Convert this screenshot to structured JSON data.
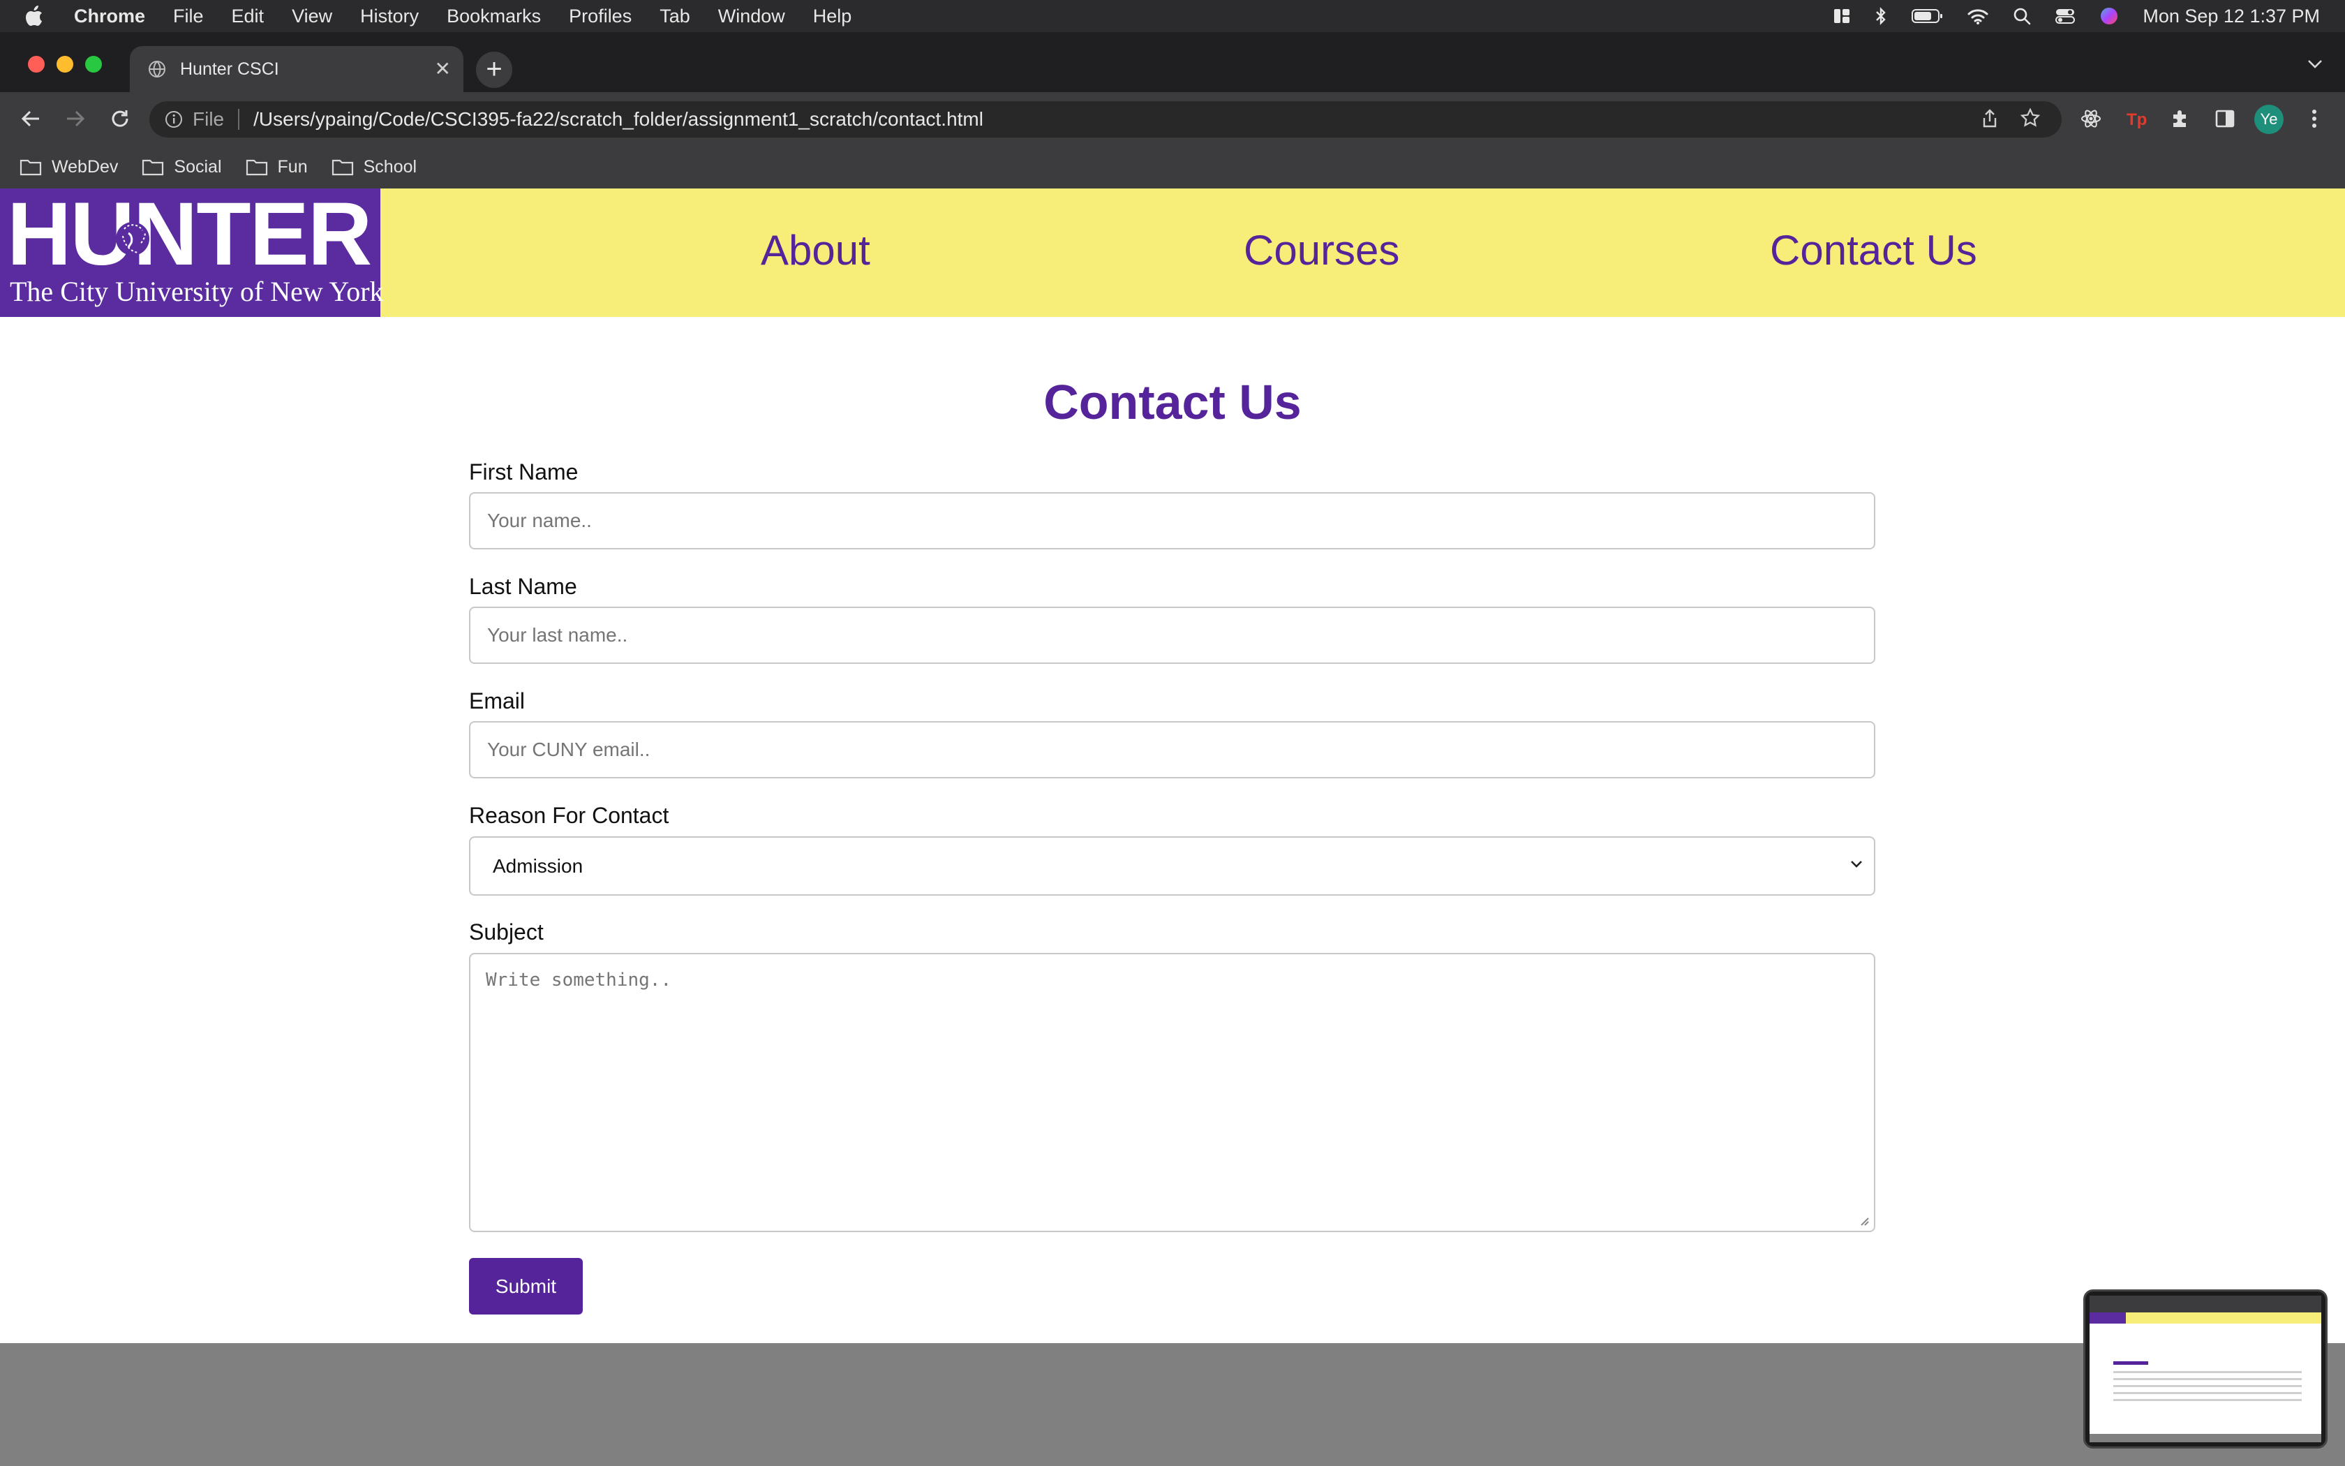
{
  "menubar": {
    "app": "Chrome",
    "items": [
      "File",
      "Edit",
      "View",
      "History",
      "Bookmarks",
      "Profiles",
      "Tab",
      "Window",
      "Help"
    ],
    "clock": "Mon Sep 12  1:37 PM"
  },
  "tab": {
    "title": "Hunter CSCI"
  },
  "omnibox": {
    "scheme": "File",
    "url": "/Users/ypaing/Code/CSCI395-fa22/scratch_folder/assignment1_scratch/contact.html"
  },
  "profile": {
    "initials": "Ye"
  },
  "bookmarks": [
    "WebDev",
    "Social",
    "Fun",
    "School"
  ],
  "site": {
    "logo_big": "HUNTER",
    "logo_sub": "The City University of New York",
    "nav": [
      "About",
      "Courses",
      "Contact Us"
    ],
    "colors": {
      "nav_bg": "#f7ed79",
      "brand_purple": "#55239a",
      "footer": "#808080"
    }
  },
  "form": {
    "title": "Contact Us",
    "first_name": {
      "label": "First Name",
      "placeholder": "Your name.."
    },
    "last_name": {
      "label": "Last Name",
      "placeholder": "Your last name.."
    },
    "email": {
      "label": "Email",
      "placeholder": "Your CUNY email.."
    },
    "reason": {
      "label": "Reason For Contact",
      "selected": "Admission"
    },
    "subject": {
      "label": "Subject",
      "placeholder": "Write something.."
    },
    "submit": "Submit"
  }
}
